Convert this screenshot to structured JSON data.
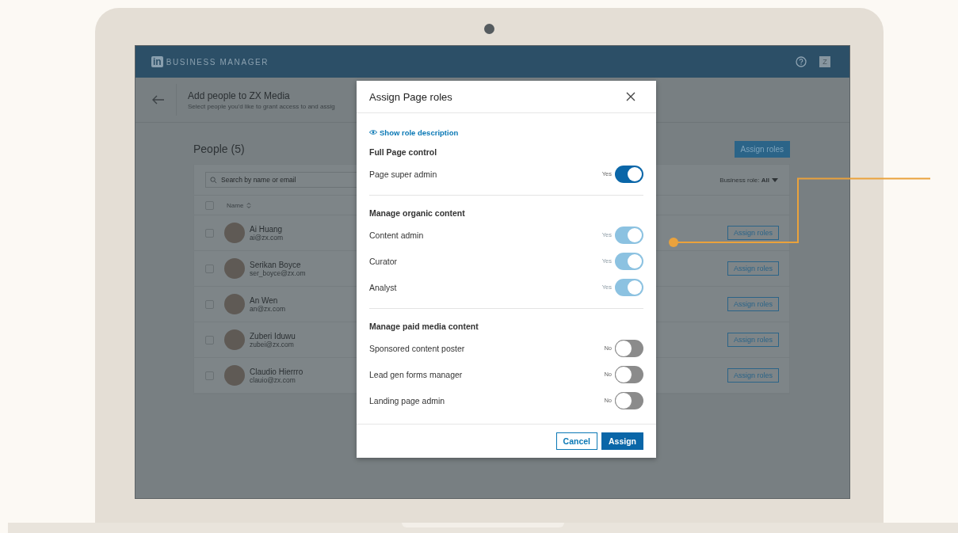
{
  "app": {
    "brand_mark": "in",
    "brand": "BUSINESS MANAGER",
    "user_initial": "Z"
  },
  "subheader": {
    "title": "Add people to ZX Media",
    "subtitle": "Select people you'd like to grant access to and assig"
  },
  "people": {
    "title": "People (5)",
    "assign_button": "Assign roles",
    "search_placeholder": "Search by name or email",
    "filter": "Business role: **All**",
    "name_column": "Name",
    "select_all_checked": false,
    "rows": [
      {
        "name": "Ai Huang",
        "email": "ai@zx.com",
        "button": "Assign roles",
        "checked": false
      },
      {
        "name": "Serikan Boyce",
        "email": "ser_boyce@zx.om",
        "button": "Assign roles",
        "checked": false
      },
      {
        "name": "An Wen",
        "email": "an@zx.com",
        "button": "Assign roles",
        "checked": false
      },
      {
        "name": "Zuberi Iduwu",
        "email": "zubei@zx.com",
        "button": "Assign roles",
        "checked": false
      },
      {
        "name": "Claudio Hierrro",
        "email": "clauio@zx.com",
        "button": "Assign roles",
        "checked": false
      }
    ]
  },
  "dialog": {
    "title": "Assign Page roles",
    "link": "Show role description",
    "sections": [
      {
        "title": "Full Page control",
        "roles": [
          {
            "label": "Page super admin",
            "state": "Yes",
            "on": true,
            "disabled": false
          }
        ]
      },
      {
        "title": "Manage organic content",
        "roles": [
          {
            "label": "Content admin",
            "state": "Yes",
            "on": true,
            "disabled": true
          },
          {
            "label": "Curator",
            "state": "Yes",
            "on": true,
            "disabled": true
          },
          {
            "label": "Analyst",
            "state": "Yes",
            "on": true,
            "disabled": true
          }
        ]
      },
      {
        "title": "Manage paid media content",
        "roles": [
          {
            "label": "Sponsored content poster",
            "state": "No",
            "on": false,
            "disabled": false
          },
          {
            "label": "Lead gen forms manager",
            "state": "No",
            "on": false,
            "disabled": false
          },
          {
            "label": "Landing page admin",
            "state": "No",
            "on": false,
            "disabled": false
          }
        ]
      }
    ],
    "buttons": [
      "Cancel",
      "Assign"
    ]
  }
}
